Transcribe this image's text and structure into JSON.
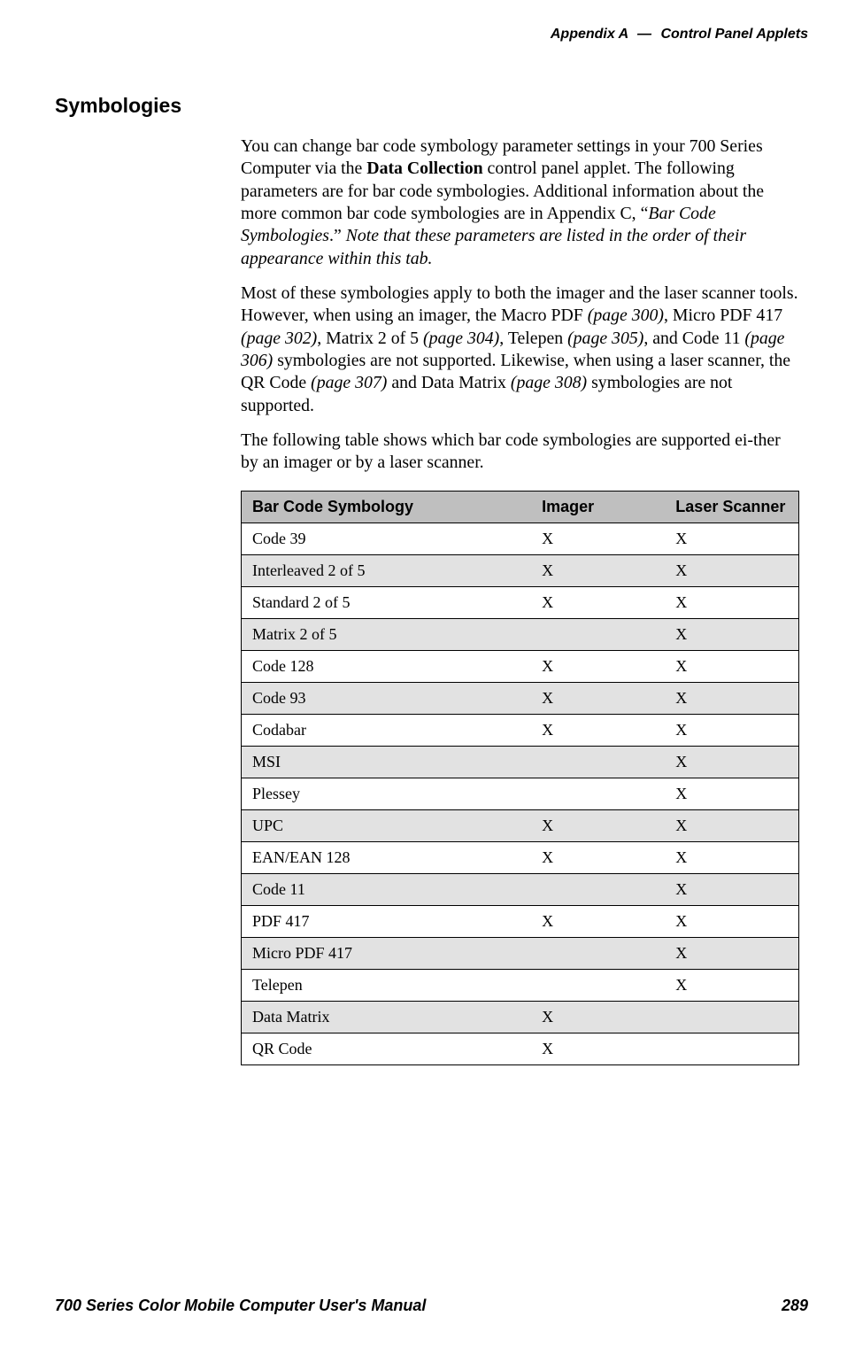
{
  "header": {
    "appendix": "Appendix A",
    "dash": "—",
    "section": "Control Panel Applets"
  },
  "title": "Symbologies",
  "paragraphs": {
    "p1a": "You can change bar code symbology parameter settings in your 700 Series Computer via the ",
    "p1b": "Data Collection",
    "p1c": " control panel applet. The following parameters are for bar code symbologies. Additional information about the more common bar code symbologies are in Appendix C, “",
    "p1d": "Bar Code Symbologies",
    "p1e": ".” ",
    "p1f": "Note that these parameters are listed in the order of their appearance within this tab.",
    "p2a": "Most of these symbologies apply to both the imager and the laser scanner tools. However, when using an imager, the Macro PDF ",
    "p2b": "(page 300)",
    "p2c": ", Micro PDF 417 ",
    "p2d": "(page 302)",
    "p2e": ", Matrix 2 of 5 ",
    "p2f": "(page 304)",
    "p2g": ", Telepen ",
    "p2h": "(page 305)",
    "p2i": ", and Code 11 ",
    "p2j": "(page 306)",
    "p2k": " symbologies are not supported. Likewise, when using a laser scanner, the QR Code ",
    "p2l": "(page 307)",
    "p2m": " and Data Matrix ",
    "p2n": "(page 308)",
    "p2o": " symbologies are not supported.",
    "p3": "The following table shows which bar code symbologies are supported ei-ther by an imager or by a laser scanner."
  },
  "table": {
    "headers": {
      "c1": "Bar Code Symbology",
      "c2": "Imager",
      "c3": "Laser Scanner"
    },
    "rows": [
      {
        "name": "Code 39",
        "imager": "X",
        "laser": "X",
        "shade": false
      },
      {
        "name": "Interleaved 2 of 5",
        "imager": "X",
        "laser": "X",
        "shade": true
      },
      {
        "name": "Standard 2 of 5",
        "imager": "X",
        "laser": "X",
        "shade": false
      },
      {
        "name": "Matrix 2 of 5",
        "imager": "",
        "laser": "X",
        "shade": true
      },
      {
        "name": "Code 128",
        "imager": "X",
        "laser": "X",
        "shade": false
      },
      {
        "name": "Code 93",
        "imager": "X",
        "laser": "X",
        "shade": true
      },
      {
        "name": "Codabar",
        "imager": "X",
        "laser": "X",
        "shade": false
      },
      {
        "name": "MSI",
        "imager": "",
        "laser": "X",
        "shade": true
      },
      {
        "name": "Plessey",
        "imager": "",
        "laser": "X",
        "shade": false
      },
      {
        "name": "UPC",
        "imager": "X",
        "laser": "X",
        "shade": true
      },
      {
        "name": "EAN/EAN 128",
        "imager": "X",
        "laser": "X",
        "shade": false
      },
      {
        "name": "Code 11",
        "imager": "",
        "laser": "X",
        "shade": true
      },
      {
        "name": "PDF 417",
        "imager": "X",
        "laser": "X",
        "shade": false
      },
      {
        "name": "Micro PDF 417",
        "imager": "",
        "laser": "X",
        "shade": true
      },
      {
        "name": "Telepen",
        "imager": "",
        "laser": "X",
        "shade": false
      },
      {
        "name": "Data Matrix",
        "imager": "X",
        "laser": "",
        "shade": true
      },
      {
        "name": "QR Code",
        "imager": "X",
        "laser": "",
        "shade": false
      }
    ]
  },
  "footer": {
    "left": "700 Series Color Mobile Computer User's Manual",
    "right": "289"
  }
}
